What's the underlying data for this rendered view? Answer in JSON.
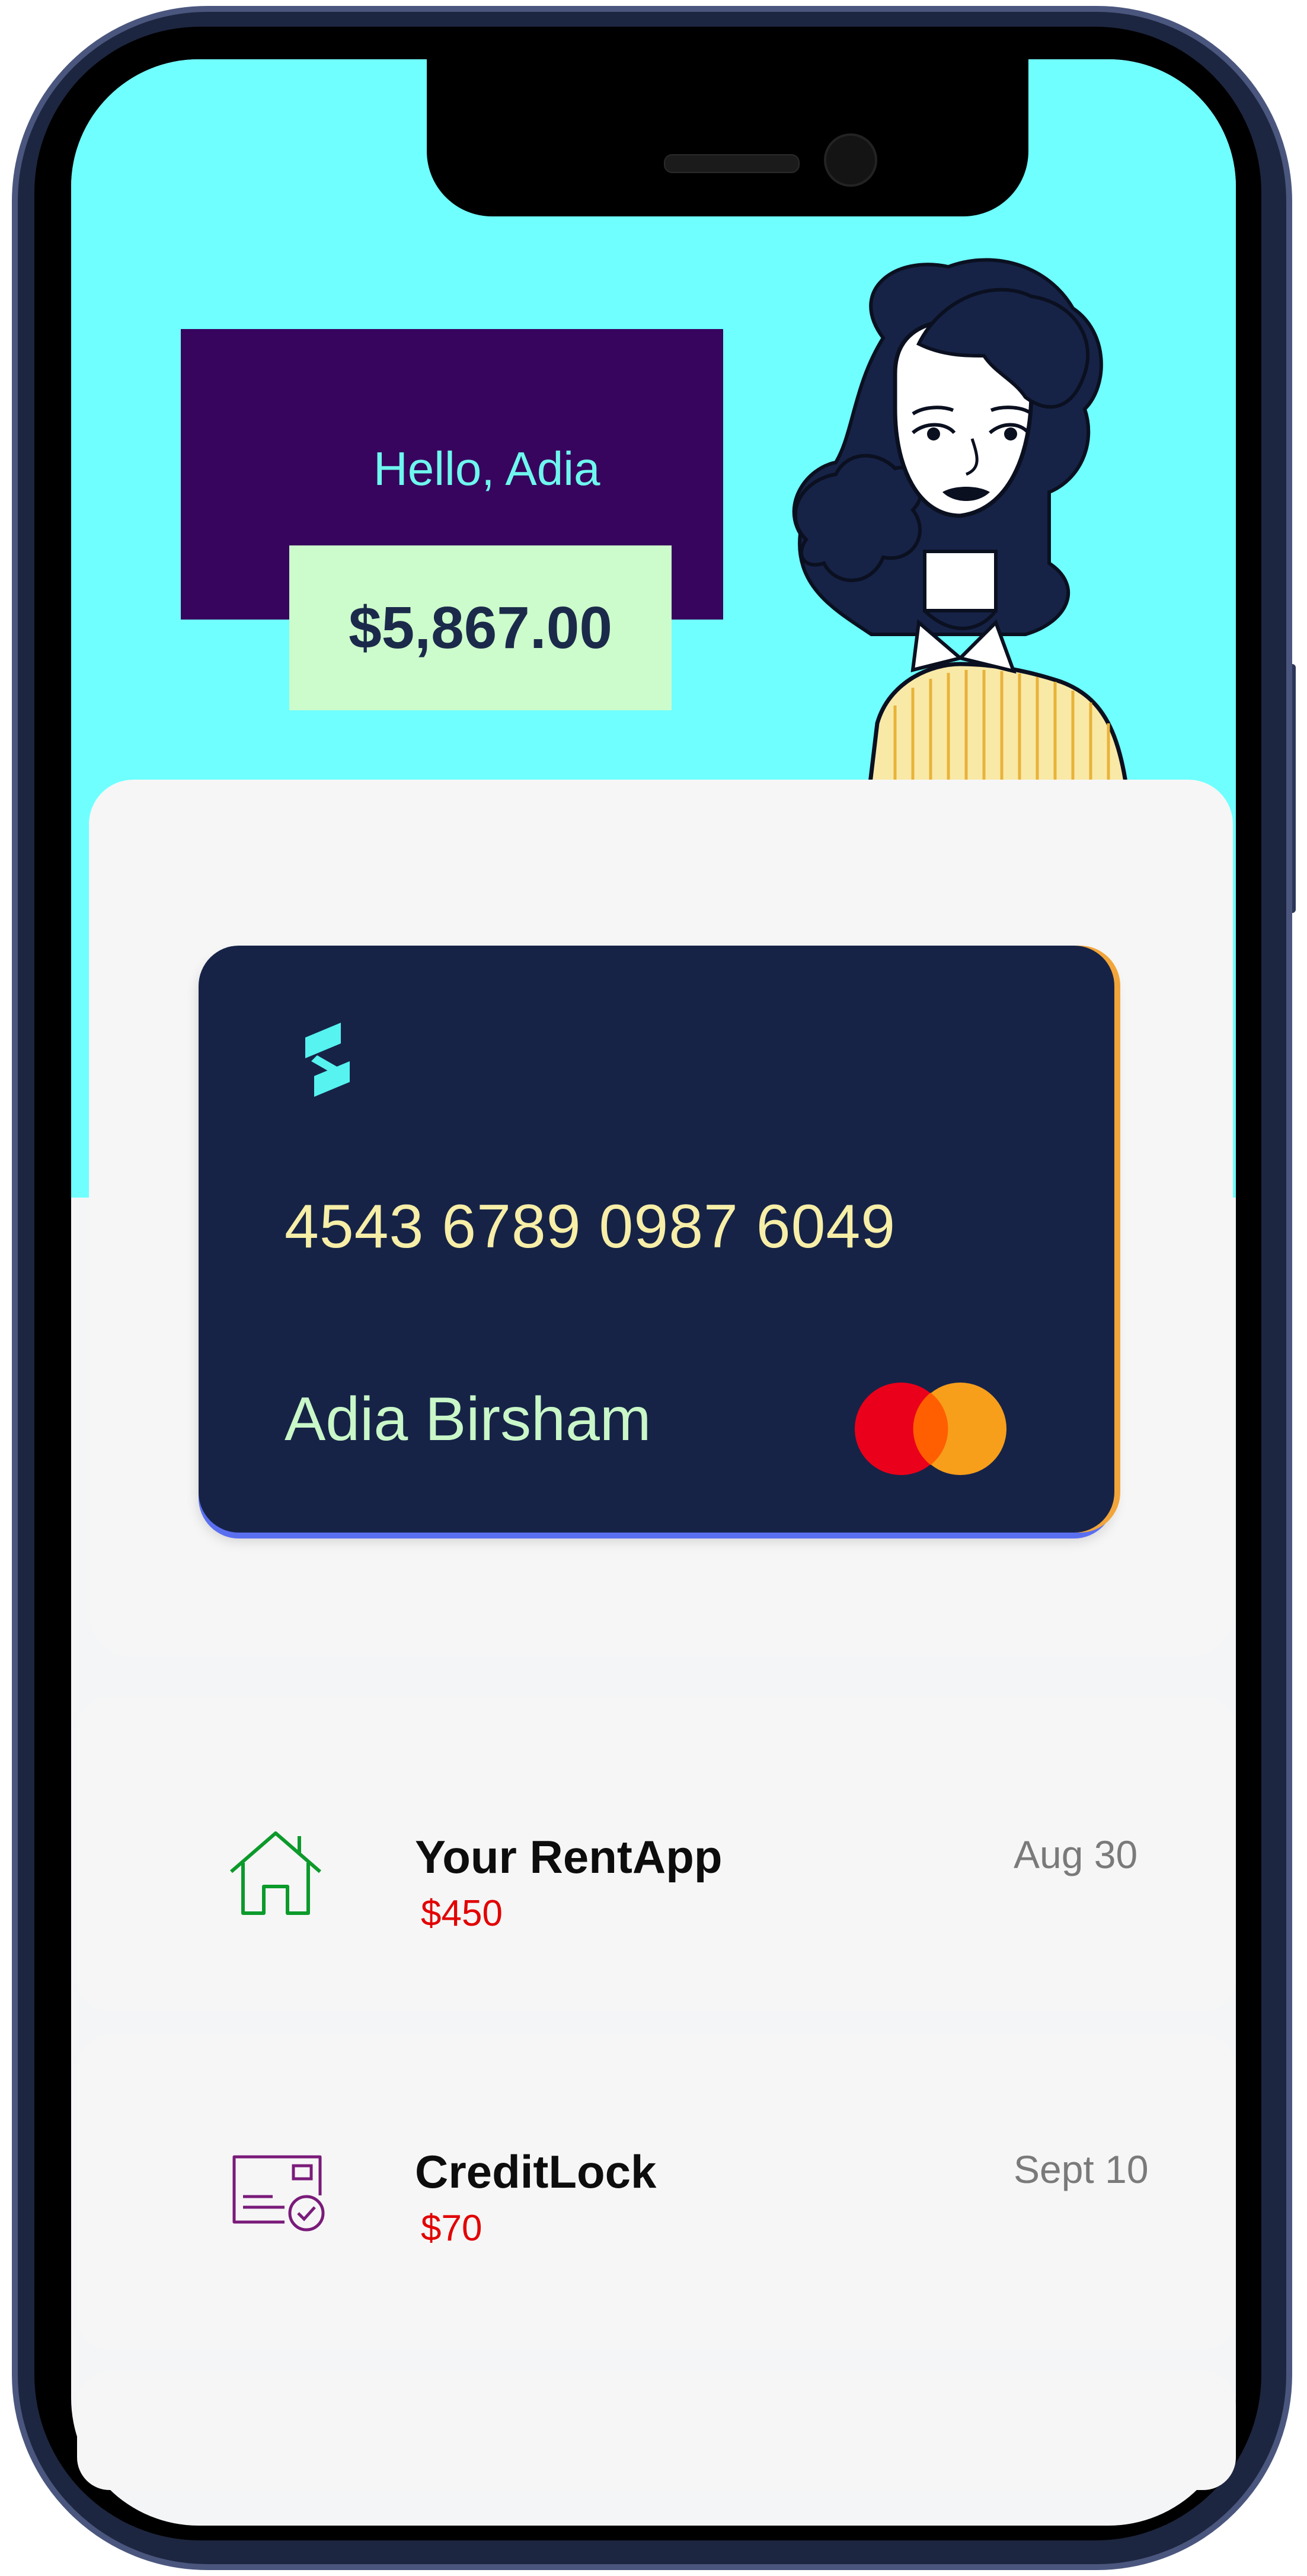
{
  "greeting": {
    "text": "Hello, Adia"
  },
  "balance": {
    "amount": "$5,867.00"
  },
  "card": {
    "number": "4543 6789 0987 6049",
    "holder": "Adia Birsham",
    "network_icon": "mastercard-logo",
    "brand_icon": "bank-logo-icon"
  },
  "transactions": [
    {
      "icon": "house-icon",
      "title": "Your RentApp",
      "amount": "$450",
      "date": "Aug 30"
    },
    {
      "icon": "credit-card-check-icon",
      "title": "CreditLock",
      "amount": "$70",
      "date": "Sept 10"
    }
  ],
  "colors": {
    "hero_bg": "#6fffff",
    "greeting_bg": "#37045e",
    "balance_bg": "#cdfccc",
    "card_bg": "#162347",
    "amount_red": "#e20000",
    "house_icon": "#0c9a2b",
    "creditlock_icon": "#7a1b7a"
  }
}
